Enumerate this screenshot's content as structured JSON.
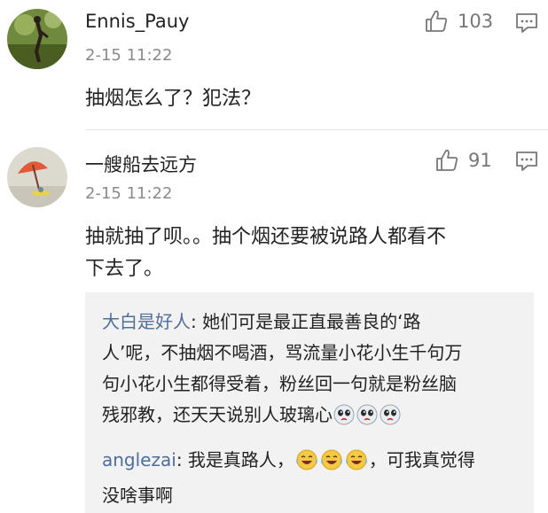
{
  "comments": [
    {
      "username": "Ennis_Pauy",
      "time": "2-15 11:22",
      "likes": "103",
      "text": "抽烟怎么了？犯法？",
      "avatar_icon": "avatar-figure-icon"
    },
    {
      "username": "一艘船去远方",
      "time": "2-15 11:22",
      "likes": "91",
      "text_line1": "抽就抽了呗。。抽个烟还要被说路人都看不",
      "text_line2": "下去了。",
      "avatar_icon": "avatar-umbrella-icon"
    }
  ],
  "replies": [
    {
      "author": "大白是好人",
      "sep": ":",
      "line1": " 她们可是最正直最善良的‘路",
      "line2": "人’呢，不抽烟不喝酒，骂流量小花小生千句万",
      "line3": "句小花小生都得受着，粉丝回一句就是粉丝脑",
      "line4": "残邪教，还天天说别人玻璃心",
      "emoji": "cry-face-emoji"
    },
    {
      "author": "anglezai",
      "sep": ":",
      "line1a": " 我是真路人，",
      "line1b": "，可我真觉得",
      "line2": "没啥事啊",
      "emoji": "laugh-tears-emoji"
    }
  ],
  "colors": {
    "accent_link": "#4f6e99",
    "meta_gray": "#8a8a8a",
    "reply_bg": "#f2f2f2"
  }
}
